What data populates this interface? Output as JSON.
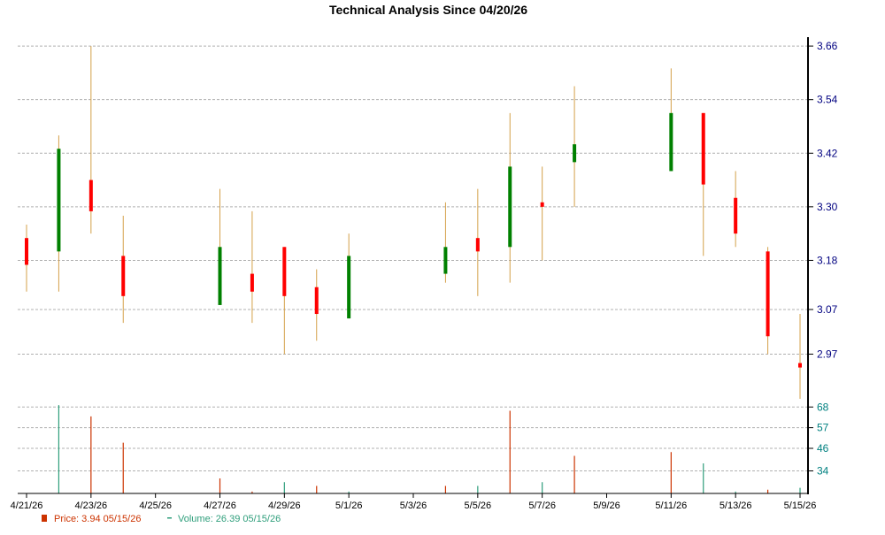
{
  "chart_data": [
    {
      "type": "candlestick",
      "title": "Technical Analysis Since 04/20/26",
      "x": [
        "4/21/26",
        "4/22/26",
        "4/23/26",
        "4/24/26",
        "4/27/26",
        "4/28/26",
        "4/29/26",
        "4/30/26",
        "5/1/26",
        "5/4/26",
        "5/5/26",
        "5/6/26",
        "5/7/26",
        "5/8/26",
        "5/11/26",
        "5/12/26",
        "5/13/26",
        "5/14/26",
        "5/15/26"
      ],
      "open": [
        3.23,
        3.2,
        3.36,
        3.19,
        3.08,
        3.15,
        3.21,
        3.12,
        3.05,
        3.15,
        3.23,
        3.21,
        3.31,
        3.4,
        3.38,
        3.51,
        3.32,
        3.2,
        2.95
      ],
      "close": [
        3.17,
        3.43,
        3.29,
        3.1,
        3.21,
        3.11,
        3.1,
        3.06,
        3.19,
        3.21,
        3.2,
        3.39,
        3.3,
        3.44,
        3.51,
        3.35,
        3.24,
        3.01,
        2.94
      ],
      "high": [
        3.26,
        3.46,
        3.66,
        3.28,
        3.34,
        3.29,
        3.21,
        3.16,
        3.24,
        3.31,
        3.34,
        3.51,
        3.39,
        3.57,
        3.61,
        3.51,
        3.38,
        3.21,
        3.06
      ],
      "low": [
        3.11,
        3.11,
        3.24,
        3.04,
        3.08,
        3.04,
        2.97,
        3.0,
        3.05,
        3.13,
        3.1,
        3.13,
        3.18,
        3.3,
        3.38,
        3.19,
        3.21,
        2.97,
        2.87
      ],
      "y_ticks": [
        "3.66",
        "3.54",
        "3.42",
        "3.30",
        "3.18",
        "3.07",
        "2.97"
      ],
      "ylim": [
        2.86,
        3.68
      ],
      "grid": true,
      "up_color": "#008000",
      "down_color": "#ff0000",
      "wick_color": "#d4a049"
    },
    {
      "type": "bar",
      "x": [
        "4/21/26",
        "4/22/26",
        "4/23/26",
        "4/24/26",
        "4/27/26",
        "4/28/26",
        "4/29/26",
        "4/30/26",
        "5/1/26",
        "5/4/26",
        "5/5/26",
        "5/6/26",
        "5/7/26",
        "5/8/26",
        "5/11/26",
        "5/12/26",
        "5/13/26",
        "5/14/26",
        "5/15/26"
      ],
      "values": [
        0,
        69,
        63,
        49,
        30,
        23,
        28,
        26,
        23,
        26,
        26,
        66,
        28,
        42,
        44,
        38,
        23,
        24,
        25
      ],
      "directions": [
        "none",
        "up",
        "down",
        "down",
        "down",
        "down",
        "up",
        "down",
        "up",
        "down",
        "up",
        "down",
        "up",
        "down",
        "down",
        "up",
        "up",
        "down",
        "up"
      ],
      "y_ticks": [
        "68",
        "57",
        "46",
        "34"
      ],
      "ylim": [
        22,
        70
      ],
      "grid": true,
      "up_color": "#2e9e7b",
      "down_color": "#cc3300"
    }
  ],
  "x_axis": {
    "tick_labels": [
      "4/21/26",
      "4/23/26",
      "4/25/26",
      "4/27/26",
      "4/29/26",
      "5/1/26",
      "5/3/26",
      "5/5/26",
      "5/7/26",
      "5/9/26",
      "5/11/26",
      "5/13/26",
      "5/15/26"
    ]
  },
  "legend": {
    "price": {
      "label": "Price: 3.94  05/15/26",
      "color": "#cc3300"
    },
    "volume": {
      "label": "Volume: 26.39  05/15/26",
      "color": "#2e9e7b"
    }
  },
  "colors": {
    "axis": "#000000",
    "grid": "#b0b0b0",
    "price_tick": "#000080",
    "volume_tick": "#008080"
  }
}
